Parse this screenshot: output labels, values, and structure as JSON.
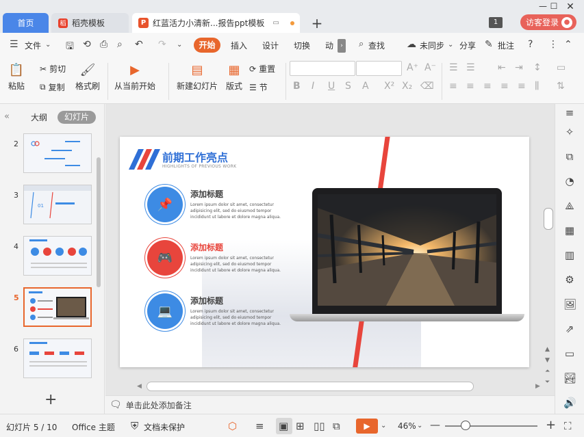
{
  "titlebar": {
    "tabs": [
      {
        "label": "首页"
      },
      {
        "label": "稻壳模板",
        "logo": "稻"
      },
      {
        "label": "红蓝活力小清新...报告ppt模板",
        "logo": "P"
      }
    ],
    "badge": "1",
    "login": "访客登录",
    "add_tab": "+"
  },
  "menubar": {
    "file": "文件",
    "tabs": [
      "开始",
      "插入",
      "设计",
      "切换",
      "动"
    ],
    "search": "查找",
    "sync": "未同步",
    "share": "分享",
    "comment": "批注"
  },
  "ribbon": {
    "paste": "粘贴",
    "cut": "剪切",
    "copy": "复制",
    "format_painter": "格式刷",
    "from_current": "从当前开始",
    "new_slide": "新建幻灯片",
    "layout": "版式",
    "reset": "重置",
    "section": "节"
  },
  "leftpanel": {
    "outline_tab": "大纲",
    "slides_tab": "幻灯片",
    "thumbs": [
      {
        "num": "2",
        "active": false
      },
      {
        "num": "3",
        "active": false
      },
      {
        "num": "4",
        "active": false
      },
      {
        "num": "5",
        "active": true
      },
      {
        "num": "6",
        "active": false
      }
    ]
  },
  "slide": {
    "title": "前期工作亮点",
    "subtitle": "HIGHLIGHTS OF PREVIOUS WORK",
    "items": [
      {
        "title": "添加标题",
        "icon": "pin-icon",
        "color": "blue",
        "body": "Lorem ipsum dolor sit amet, consectetur adipisicing elit, sed do eiusmod tempor incididunt ut labore et dolore magna aliqua."
      },
      {
        "title": "添加标题",
        "icon": "gamepad-icon",
        "color": "red",
        "body": "Lorem ipsum dolor sit amet, consectetur adipisicing elit, sed do eiusmod tempor incididunt ut labore et dolore magna aliqua."
      },
      {
        "title": "添加标题",
        "icon": "laptop-icon",
        "color": "blue",
        "body": "Lorem ipsum dolor sit amet, consectetur adipisicing elit, sed do eiusmod tempor incididunt ut labore et dolore magna aliqua."
      }
    ]
  },
  "notes_placeholder": "单击此处添加备注",
  "statusbar": {
    "slide_info": "幻灯片 5 / 10",
    "theme": "Office 主题",
    "protect": "文档未保护",
    "zoom": "46%"
  },
  "colors": {
    "accent_orange": "#e8662c",
    "brand_blue": "#2f6fd6",
    "brand_red": "#e8453c"
  }
}
